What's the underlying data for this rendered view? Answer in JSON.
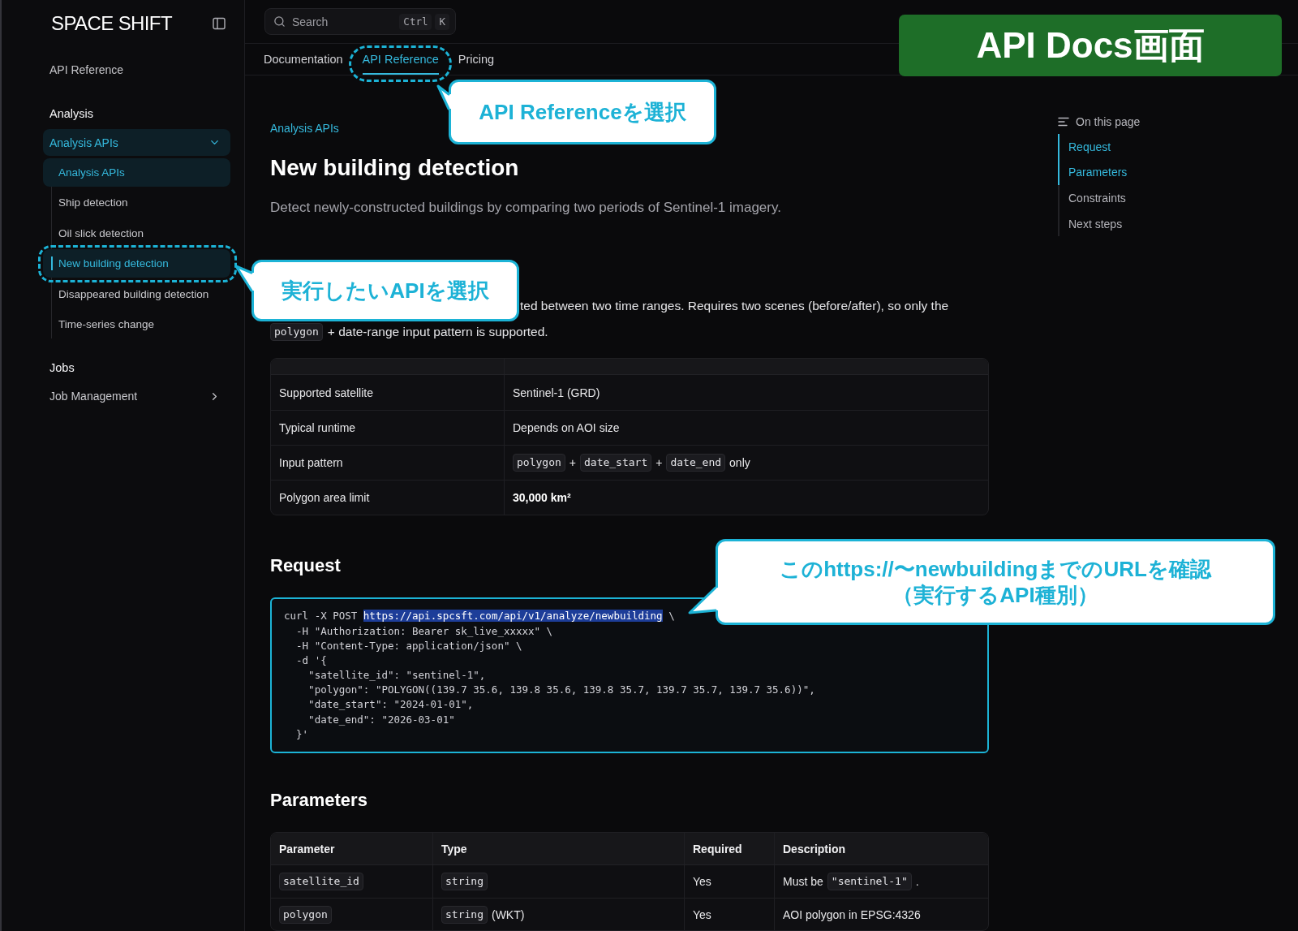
{
  "sidebar": {
    "logo": "SPACE SHIFT",
    "top_link": "API Reference",
    "sections": [
      {
        "title": "Analysis",
        "items": [
          {
            "label": "Analysis APIs",
            "expanded": true,
            "selected": true,
            "children": [
              {
                "label": "Analysis APIs",
                "selected": true,
                "current": false
              },
              {
                "label": "Ship detection",
                "selected": false,
                "current": false
              },
              {
                "label": "Oil slick detection",
                "selected": false,
                "current": false
              },
              {
                "label": "New building detection",
                "selected": true,
                "current": true
              },
              {
                "label": "Disappeared building detection",
                "selected": false,
                "current": false
              },
              {
                "label": "Time-series change",
                "selected": false,
                "current": false
              }
            ]
          }
        ]
      },
      {
        "title": "Jobs",
        "items": [
          {
            "label": "Job Management",
            "expanded": false,
            "selected": false
          }
        ]
      }
    ]
  },
  "header": {
    "search": {
      "placeholder": "Search",
      "shortcut": [
        "Ctrl",
        "K"
      ]
    },
    "tabs": [
      {
        "label": "Documentation",
        "selected": false
      },
      {
        "label": "API Reference",
        "selected": true
      },
      {
        "label": "Pricing",
        "selected": false
      }
    ]
  },
  "content": {
    "breadcrumb": "Analysis APIs",
    "title": "New building detection",
    "lead": "Detect newly-constructed buildings by comparing two periods of Sentinel-1 imagery.",
    "summary": {
      "text": "ted between two time ranges. Requires two scenes (before/after), so only the",
      "continuation": [
        {
          "kind": "code",
          "text": "polygon"
        },
        {
          "kind": "text",
          "text": "+ date-range input pattern is supported."
        }
      ]
    },
    "overview_table": {
      "rows": [
        {
          "cells": [
            [
              {
                "kind": "text",
                "text": "Supported satellite"
              }
            ],
            [
              {
                "kind": "text",
                "text": "Sentinel-1 (GRD)"
              }
            ]
          ]
        },
        {
          "cells": [
            [
              {
                "kind": "text",
                "text": "Typical runtime"
              }
            ],
            [
              {
                "kind": "text",
                "text": "Depends on AOI size"
              }
            ]
          ]
        },
        {
          "cells": [
            [
              {
                "kind": "text",
                "text": "Input pattern"
              }
            ],
            [
              {
                "kind": "code",
                "text": "polygon"
              },
              {
                "kind": "text",
                "text": "+"
              },
              {
                "kind": "code",
                "text": "date_start"
              },
              {
                "kind": "text",
                "text": "+"
              },
              {
                "kind": "code",
                "text": "date_end"
              },
              {
                "kind": "text",
                "text": "only"
              }
            ]
          ]
        },
        {
          "cells": [
            [
              {
                "kind": "text",
                "text": "Polygon area limit"
              }
            ],
            [
              {
                "kind": "strong",
                "text": "30,000 km²"
              }
            ]
          ]
        }
      ]
    },
    "request": {
      "heading": "Request",
      "code_lines": [
        [
          {
            "text": "curl -X POST ",
            "highlighted": false
          },
          {
            "text": "https://api.spcsft.com/api/v1/analyze/newbuilding",
            "highlighted": true
          },
          {
            "text": " \\",
            "highlighted": false
          }
        ],
        [
          {
            "text": "  -H \"Authorization: Bearer sk_live_xxxxx\" \\",
            "highlighted": false
          }
        ],
        [
          {
            "text": "  -H \"Content-Type: application/json\" \\",
            "highlighted": false
          }
        ],
        [
          {
            "text": "  -d '{",
            "highlighted": false
          }
        ],
        [
          {
            "text": "    \"satellite_id\": \"sentinel-1\",",
            "highlighted": false
          }
        ],
        [
          {
            "text": "    \"polygon\": \"POLYGON((139.7 35.6, 139.8 35.6, 139.8 35.7, 139.7 35.7, 139.7 35.6))\",",
            "highlighted": false
          }
        ],
        [
          {
            "text": "    \"date_start\": \"2024-01-01\",",
            "highlighted": false
          }
        ],
        [
          {
            "text": "    \"date_end\": \"2026-03-01\"",
            "highlighted": false
          }
        ],
        [
          {
            "text": "  }'",
            "highlighted": false
          }
        ]
      ]
    },
    "parameters": {
      "heading": "Parameters",
      "columns": [
        "Parameter",
        "Type",
        "Required",
        "Description"
      ],
      "rows": [
        {
          "cells": [
            [
              {
                "kind": "code",
                "text": "satellite_id"
              }
            ],
            [
              {
                "kind": "code",
                "text": "string"
              }
            ],
            [
              {
                "kind": "text",
                "text": "Yes"
              }
            ],
            [
              {
                "kind": "text",
                "text": "Must be"
              },
              {
                "kind": "code",
                "text": "\"sentinel-1\""
              },
              {
                "kind": "text",
                "text": "."
              }
            ]
          ]
        },
        {
          "cells": [
            [
              {
                "kind": "code",
                "text": "polygon"
              }
            ],
            [
              {
                "kind": "code",
                "text": "string"
              },
              {
                "kind": "text",
                "text": "(WKT)"
              }
            ],
            [
              {
                "kind": "text",
                "text": "Yes"
              }
            ],
            [
              {
                "kind": "text",
                "text": "AOI polygon in EPSG:4326"
              }
            ]
          ]
        }
      ]
    }
  },
  "toc": {
    "title": "On this page",
    "items": [
      {
        "label": "Request",
        "active": true
      },
      {
        "label": "Parameters",
        "active": true
      },
      {
        "label": "Constraints",
        "active": false
      },
      {
        "label": "Next steps",
        "active": false
      }
    ]
  },
  "annotations": {
    "banner": "API Docs画面",
    "callouts": [
      {
        "lines": [
          "API Referenceを選択"
        ]
      },
      {
        "lines": [
          "実行したいAPIを選択"
        ]
      },
      {
        "lines": [
          "このhttps://〜newbuildingまでのURLを確認",
          "（実行するAPI種別）"
        ]
      }
    ]
  }
}
